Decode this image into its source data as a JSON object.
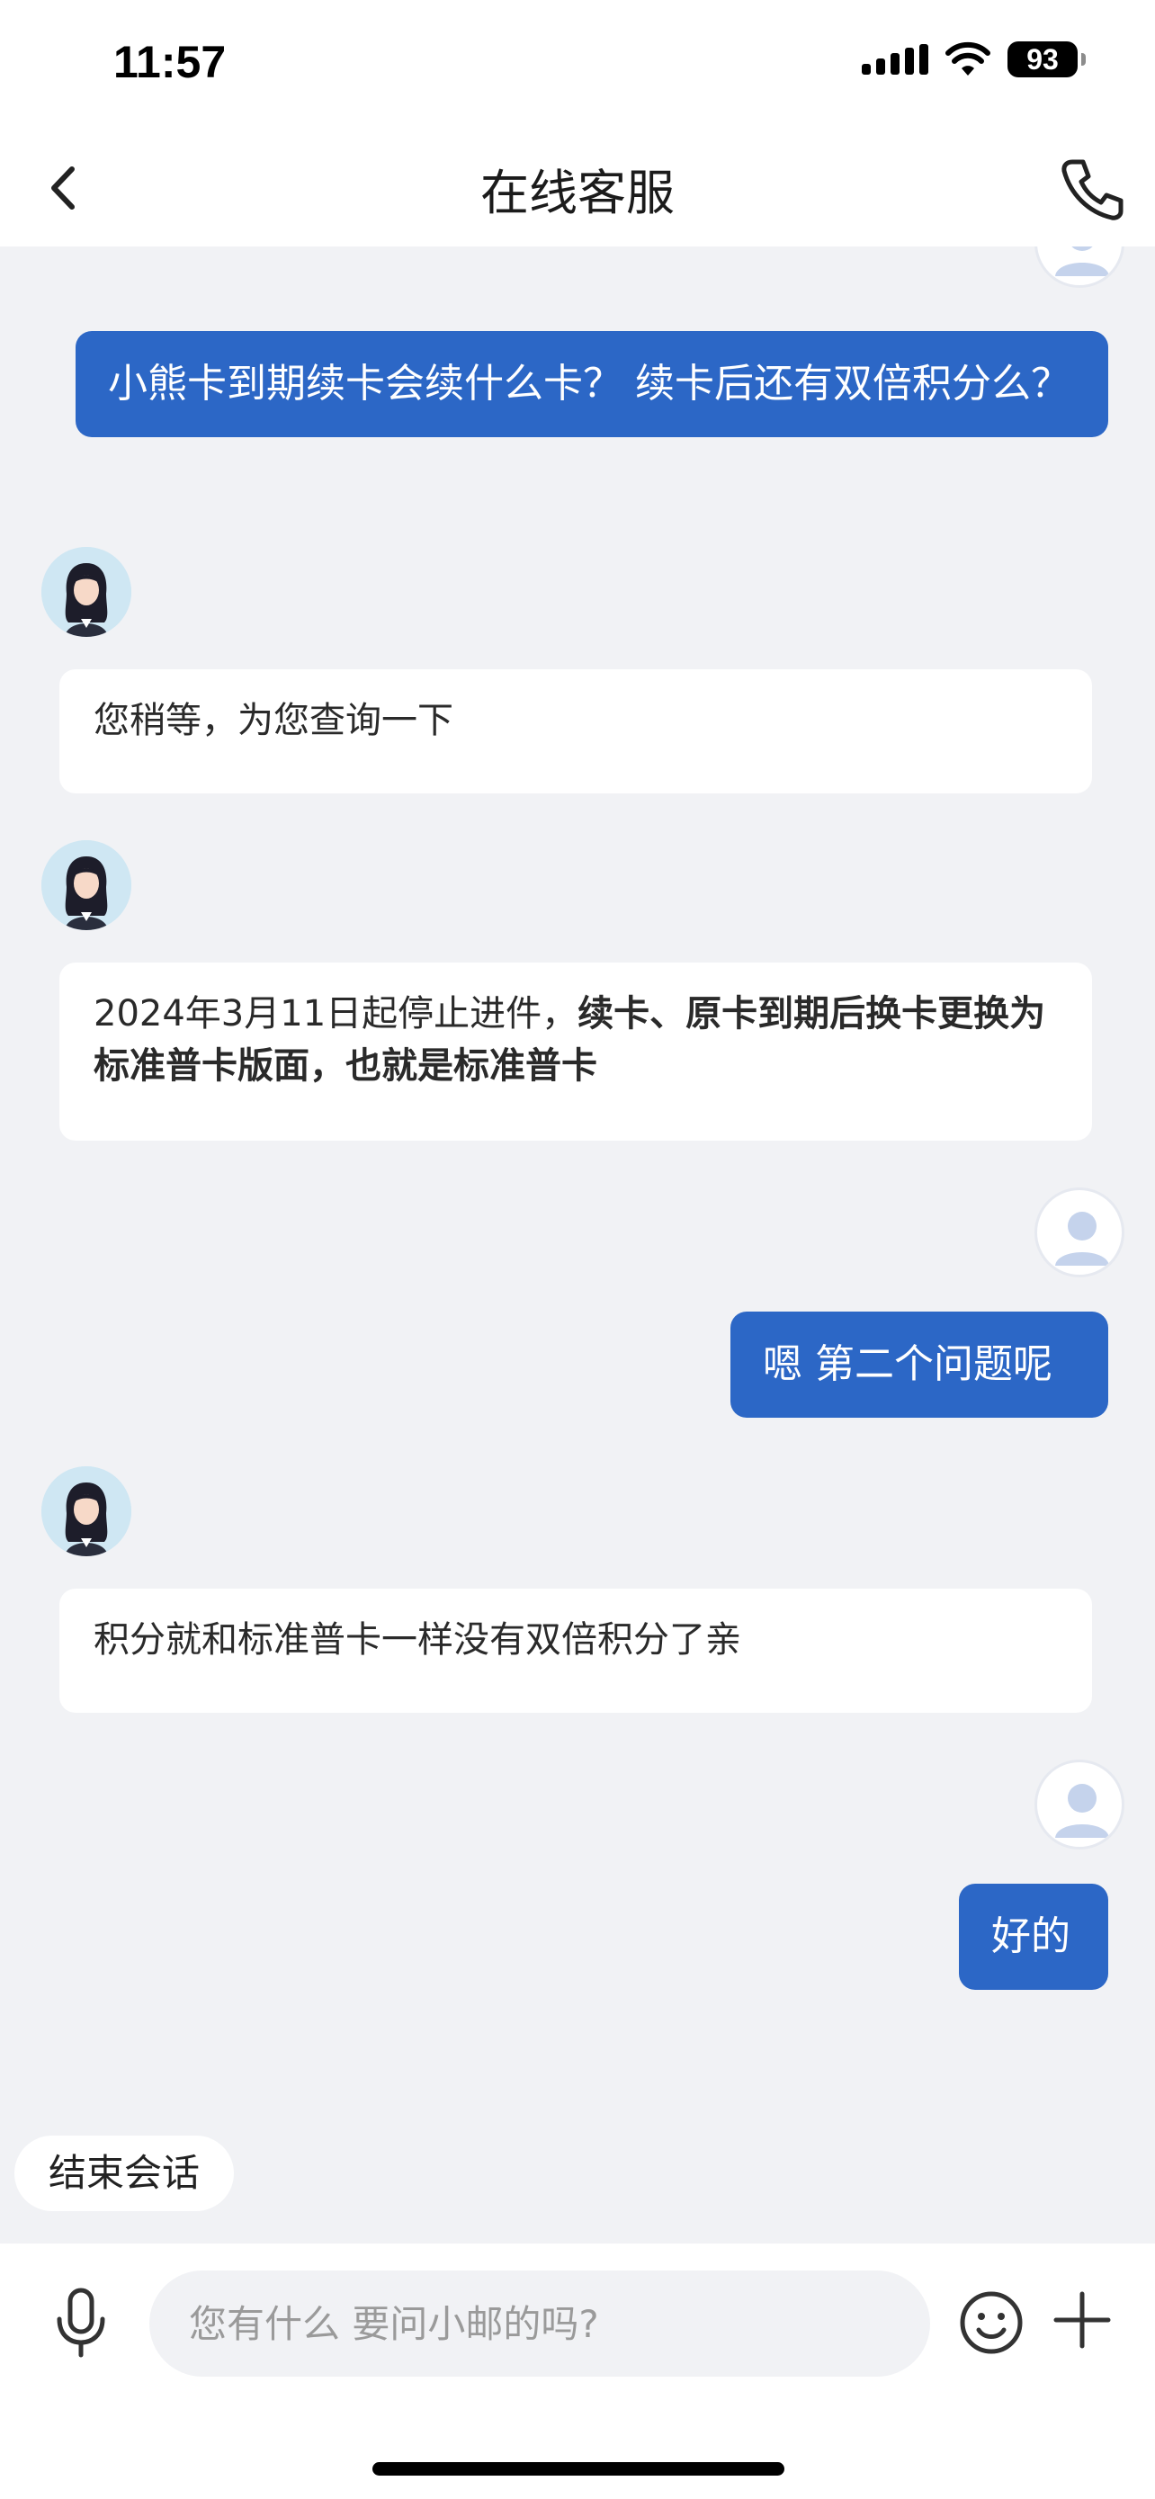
{
  "status_bar": {
    "time": "11:57",
    "battery": "93"
  },
  "header": {
    "title": "在线客服"
  },
  "messages": {
    "user_1": "小熊卡到期续卡会续什么卡？ 续卡后还有双倍积分么？",
    "agent_1": "您稍等，为您查询一下",
    "agent_2_normal": "2024年3月11日起停止进件，",
    "agent_2_bold": "续卡、原卡到期后换卡更换为标准普卡版面，也就是标准普卡",
    "user_2": "嗯 第二个问题呢",
    "agent_3": "积分就和标准普卡一样没有双倍积分了亲",
    "user_3": "好的"
  },
  "actions": {
    "end_chat_label": "结束会话"
  },
  "input": {
    "placeholder": "您有什么 要问小邮的吗?"
  },
  "colors": {
    "user_bubble": "#2c67c6",
    "background": "#f1f2f5"
  },
  "icons": [
    "back-icon",
    "phone-icon",
    "microphone-icon",
    "emoji-icon",
    "plus-icon"
  ]
}
